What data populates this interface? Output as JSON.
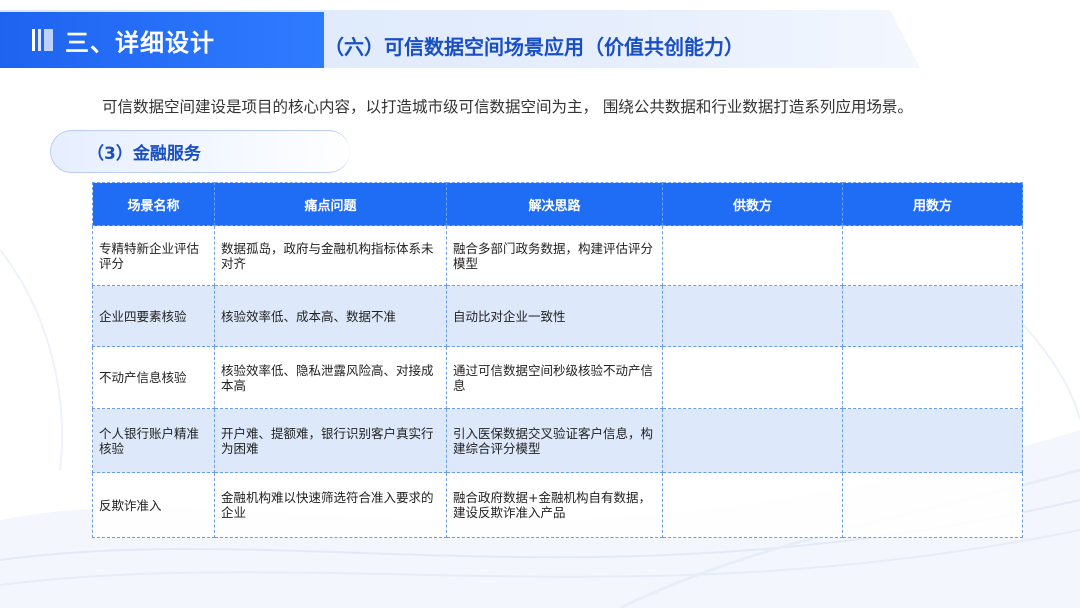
{
  "header": {
    "section_title": "三、详细设计",
    "subtitle": "（六）可信数据空间场景应用（价值共创能力）"
  },
  "intro": "可信数据空间建设是项目的核心内容，以打造城市级可信数据空间为主， 围绕公共数据和行业数据打造系列应用场景。",
  "subsection": "（3）金融服务",
  "table": {
    "headers": [
      "场景名称",
      "痛点问题",
      "解决思路",
      "供数方",
      "用数方"
    ],
    "rows": [
      [
        "专精特新企业评估评分",
        "数据孤岛，政府与金融机构指标体系未对齐",
        "融合多部门政务数据，构建评估评分模型",
        "",
        ""
      ],
      [
        "企业四要素核验",
        "核验效率低、成本高、数据不准",
        "自动比对企业一致性",
        "",
        ""
      ],
      [
        "不动产信息核验",
        "核验效率低、隐私泄露风险高、对接成本高",
        "通过可信数据空间秒级核验不动产信息",
        "",
        ""
      ],
      [
        "个人银行账户精准核验",
        "开户难、提额难，银行识别客户真实行为困难",
        "引入医保数据交叉验证客户信息，构建综合评分模型",
        "",
        ""
      ],
      [
        "反欺诈准入",
        "金融机构难以快速筛选符合准入要求的企业",
        "融合政府数据+金融机构自有数据，建设反欺诈准入产品",
        "",
        ""
      ]
    ]
  }
}
